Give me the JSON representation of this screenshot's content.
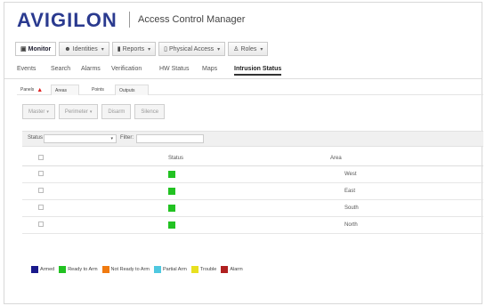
{
  "header": {
    "logo": "AVIGILON",
    "app_title": "Access Control Manager"
  },
  "main_nav": [
    {
      "label": "Monitor",
      "icon": "monitor-icon",
      "active": true,
      "dropdown": false
    },
    {
      "label": "Identities",
      "icon": "people-icon",
      "active": false,
      "dropdown": true
    },
    {
      "label": "Reports",
      "icon": "bar-chart-icon",
      "active": false,
      "dropdown": true
    },
    {
      "label": "Physical Access",
      "icon": "door-icon",
      "active": false,
      "dropdown": true
    },
    {
      "label": "Roles",
      "icon": "roles-icon",
      "active": false,
      "dropdown": true
    }
  ],
  "sub_tabs": [
    "Events",
    "Search",
    "Alarms",
    "Verification",
    "HW Status",
    "Maps",
    "Intrusion Status"
  ],
  "sub_tab_active": "Intrusion Status",
  "panel_tabs": [
    "Panels",
    "Areas",
    "Points",
    "Outputs"
  ],
  "toolbar": {
    "master_label": "Master",
    "perimeter_label": "Perimeter",
    "disarm_label": "Disarm",
    "silence_label": "Silence"
  },
  "filter": {
    "status_label": "Status",
    "filter_label": "Filter:",
    "status_value": "",
    "filter_value": ""
  },
  "table": {
    "columns": [
      "Status",
      "Area"
    ],
    "rows": [
      {
        "status": "Ready to Arm",
        "area": "West"
      },
      {
        "status": "Ready to Arm",
        "area": "East"
      },
      {
        "status": "Ready to Arm",
        "area": "South"
      },
      {
        "status": "Ready to Arm",
        "area": "North"
      }
    ]
  },
  "legend": [
    {
      "label": "Armed",
      "color": "#1a1a8c"
    },
    {
      "label": "Ready to Arm",
      "color": "#22c222"
    },
    {
      "label": "Not Ready to Arm",
      "color": "#f07a10"
    },
    {
      "label": "Partial Arm",
      "color": "#4fc8e0"
    },
    {
      "label": "Trouble",
      "color": "#e8e020"
    },
    {
      "label": "Alarm",
      "color": "#b02020"
    }
  ],
  "colors": {
    "brand": "#2a3a8f",
    "ready_status": "#22c222",
    "warning": "#e02020"
  }
}
